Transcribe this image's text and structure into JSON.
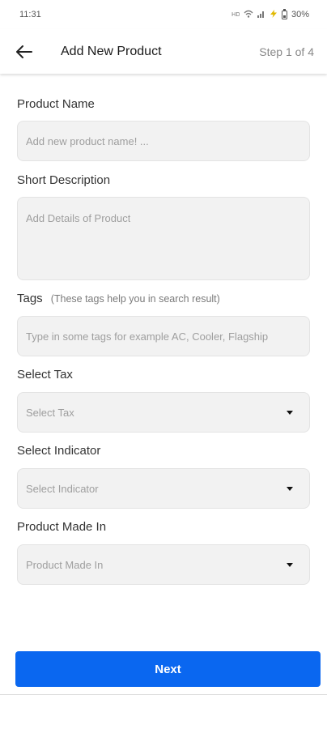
{
  "status_bar": {
    "time": "11:31",
    "icons": [
      "signal-hd-icon",
      "wifi-icon",
      "cell-signal-icon",
      "charging-icon",
      "battery-icon"
    ],
    "battery": "30%"
  },
  "app_bar": {
    "title": "Add New Product",
    "step": "Step 1 of 4"
  },
  "form": {
    "product_name": {
      "label": "Product Name",
      "placeholder": "Add new product name! ..."
    },
    "short_description": {
      "label": "Short Description",
      "placeholder": "Add Details of Product"
    },
    "tags": {
      "label": "Tags",
      "hint": "(These tags help you in search result)",
      "placeholder": "Type in some tags for example AC, Cooler, Flagship"
    },
    "tax": {
      "label": "Select Tax",
      "value": "Select Tax"
    },
    "indicator": {
      "label": "Select Indicator",
      "value": "Select Indicator"
    },
    "made_in": {
      "label": "Product Made In",
      "value": "Product Made In"
    }
  },
  "actions": {
    "next_label": "Next"
  },
  "colors": {
    "primary": "#0a67f0",
    "field_bg": "#f2f2f2",
    "placeholder": "#9e9e9e"
  }
}
